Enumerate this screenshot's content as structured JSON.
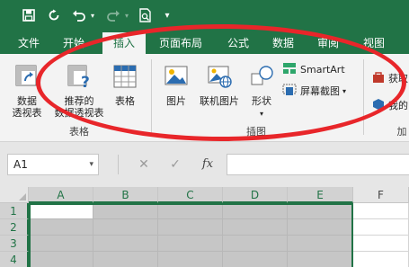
{
  "colors": {
    "accent": "#217346",
    "annotation": "#e8262a"
  },
  "qat": {
    "save_icon": "save-icon",
    "autosave_icon": "autosave-icon",
    "undo_icon": "undo-icon",
    "redo_icon": "redo-icon",
    "print_preview_icon": "print-preview-icon",
    "customize_icon": "customize-qat-icon"
  },
  "tabs": [
    "文件",
    "开始",
    "插入",
    "页面布局",
    "公式",
    "数据",
    "审阅",
    "视图"
  ],
  "active_tab": "插入",
  "ribbon": {
    "tables_group": {
      "pivot_table": [
        "数据",
        "透视表"
      ],
      "recommended_pivot": [
        "推荐的",
        "数据透视表"
      ],
      "table": "表格",
      "label": "表格"
    },
    "illustrations_group": {
      "pictures": "图片",
      "online_pictures": "联机图片",
      "shapes": "形状",
      "smartart": "SmartArt",
      "screenshot": "屏幕截图",
      "label": "插图"
    },
    "addins_group": {
      "get_addins": "获取",
      "my_addins": "我的",
      "label": "加"
    }
  },
  "formula_bar": {
    "name_box": "A1",
    "cancel": "✕",
    "enter": "✓",
    "fx": "fx",
    "formula": ""
  },
  "sheet": {
    "columns": [
      "A",
      "B",
      "C",
      "D",
      "E",
      "F"
    ],
    "rows": [
      "1",
      "2",
      "3",
      "4"
    ]
  }
}
